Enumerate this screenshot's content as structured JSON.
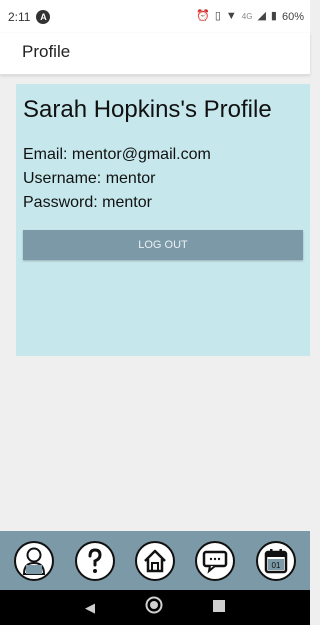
{
  "status_bar": {
    "time": "2:11",
    "battery": "60%",
    "network": "4G"
  },
  "app_bar": {
    "title": "Profile"
  },
  "profile": {
    "heading": "Sarah Hopkins's Profile",
    "email_line": "Email: mentor@gmail.com",
    "username_line": "Username: mentor",
    "password_line": "Password: mentor",
    "logout_label": "LOG OUT"
  },
  "bottom_nav": {
    "items": [
      {
        "icon": "profile-icon"
      },
      {
        "icon": "help-icon"
      },
      {
        "icon": "home-icon"
      },
      {
        "icon": "chat-icon"
      },
      {
        "icon": "calendar-icon",
        "label": "01"
      }
    ]
  },
  "colors": {
    "card": "#c6e8ec",
    "accent": "#7c99a8",
    "page_bg": "#efefef"
  }
}
